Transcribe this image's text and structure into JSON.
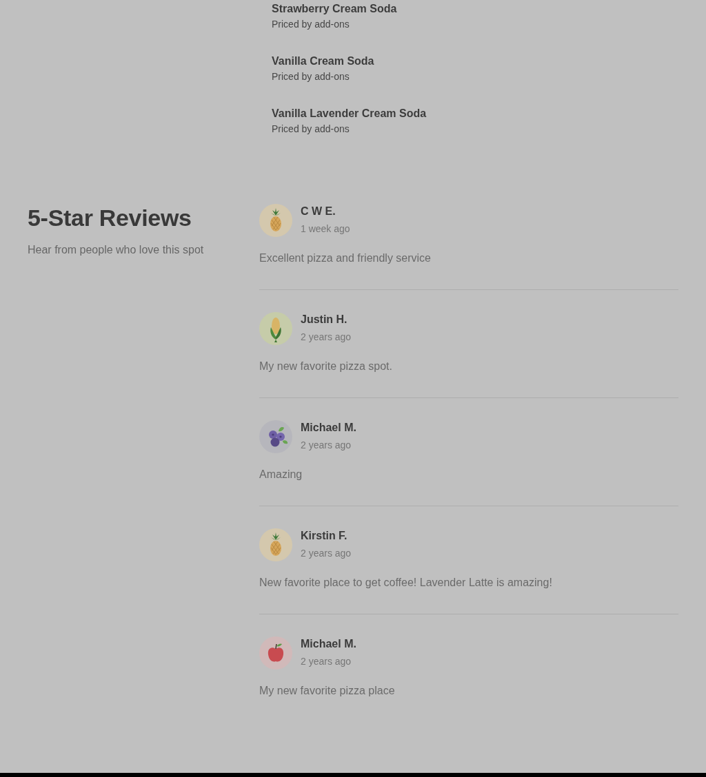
{
  "menu_items": [
    {
      "name": "Strawberry Cream Soda",
      "price": "Priced by add-ons"
    },
    {
      "name": "Vanilla Cream Soda",
      "price": "Priced by add-ons"
    },
    {
      "name": "Vanilla Lavender Cream Soda",
      "price": "Priced by add-ons"
    }
  ],
  "reviews_section": {
    "title": "5-Star Reviews",
    "subtitle": "Hear from people who love this spot"
  },
  "reviews": [
    {
      "avatar": {
        "kind": "pineapple"
      },
      "author": "C W E.",
      "time": "1 week ago",
      "text": "Excellent pizza and friendly service"
    },
    {
      "avatar": {
        "kind": "corn"
      },
      "author": "Justin H.",
      "time": "2 years ago",
      "text": "My new favorite pizza spot."
    },
    {
      "avatar": {
        "kind": "blueberries"
      },
      "author": "Michael M.",
      "time": "2 years ago",
      "text": "Amazing"
    },
    {
      "avatar": {
        "kind": "pineapple"
      },
      "author": "Kirstin F.",
      "time": "2 years ago",
      "text": "New favorite place to get coffee! Lavender Latte is amazing!"
    },
    {
      "avatar": {
        "kind": "apple"
      },
      "author": "Michael M.",
      "time": "2 years ago",
      "text": "My new favorite pizza place"
    }
  ]
}
